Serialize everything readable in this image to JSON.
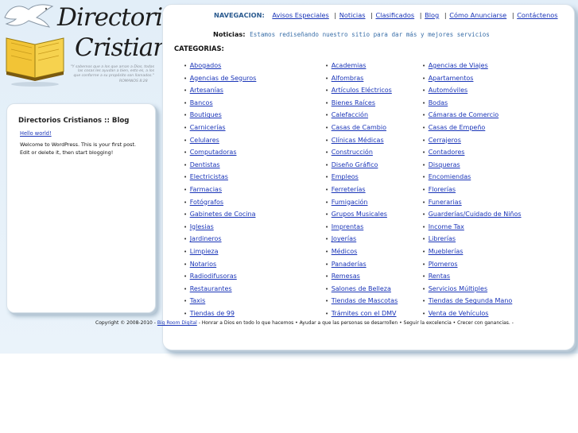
{
  "logo": {
    "line1": "Directorios",
    "line2": "Cristianos",
    "verse": "\"Y sabemos que a los que aman a Dios, todas las cosas les ayudan a bien, esto es, a los que conforme a su propósito son llamados.\"",
    "verse_ref": "ROMANOS 8:28"
  },
  "sidebar": {
    "title": "Directorios Cristianos :: Blog",
    "post_title": "Hello world!",
    "post_body": "Welcome to WordPress. This is your first post. Edit or delete it, then start blogging!"
  },
  "nav": {
    "label": "NAVEGACION:",
    "items": [
      "Avisos Especiales",
      "Noticias",
      "Clasificados",
      "Blog",
      "Cómo Anunciarse",
      "Contáctenos"
    ],
    "separator": "|"
  },
  "news": {
    "label": "Noticias:",
    "text": "Estamos rediseñando nuestro sitio para dar más y mejores servicios"
  },
  "categories": {
    "heading": "CATEGORIAS:",
    "bullet": "•",
    "col1": [
      "Abogados",
      "Agencias de Seguros",
      "Artesanías",
      "Bancos",
      "Boutiques",
      "Carnicerías",
      "Celulares",
      "Computadoras",
      "Dentistas",
      "Electricistas",
      "Farmacias",
      "Fotógrafos",
      "Gabinetes de Cocina",
      "Iglesias",
      "Jardineros",
      "Limpieza",
      "Notarios",
      "Radiodifusoras",
      "Restaurantes",
      "Taxis",
      "Tiendas de 99"
    ],
    "col2": [
      "Academias",
      "Alfombras",
      "Artículos Eléctricos",
      "Bienes Raíces",
      "Calefacción",
      "Casas de Cambio",
      "Clínicas Médicas",
      "Construcción",
      "Diseño Gráfico",
      "Empleos",
      "Ferreterías",
      "Fumigación",
      "Grupos Musicales",
      "Imprentas",
      "Joyerías",
      "Médicos",
      "Panaderías",
      "Remesas",
      "Salones de Belleza",
      "Tiendas de Mascotas",
      "Trámites con el DMV"
    ],
    "col3": [
      "Agencias de Viajes",
      "Apartamentos",
      "Automóviles",
      "Bodas",
      "Cámaras de Comercio",
      "Casas de Empeño",
      "Cerrajeros",
      "Contadores",
      "Disqueras",
      "Encomiendas",
      "Florerías",
      "Funerarias",
      "Guarderías/Cuidado de Niños",
      "Income Tax",
      "Librerías",
      "Mueblerías",
      "Plomeros",
      "Rentas",
      "Servicios Múltiples",
      "Tiendas de Segunda Mano",
      "Venta de Vehículos"
    ]
  },
  "footer": {
    "copyright": "Copyright © 2008-2010 -",
    "link": "Big Room Digital",
    "tagline": "- Honrar a Dios en todo lo que hacemos • Ayudar a que las personas se desarrollen • Seguir la excelencia • Crecer con ganancias. -"
  },
  "colors": {
    "link": "#1a35b8",
    "nav_label": "#2a5a8f",
    "news_text": "#3a6fa8",
    "background": "#e2eef8"
  }
}
